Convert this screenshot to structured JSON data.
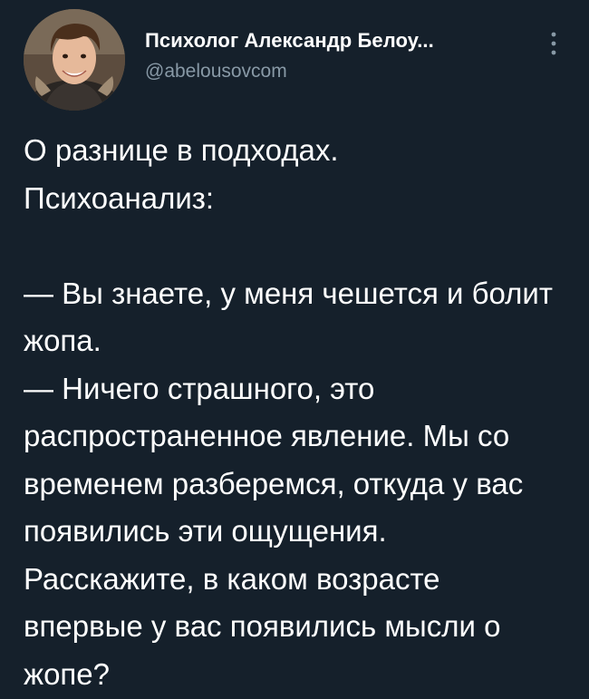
{
  "author": {
    "display_name": "Психолог Александр Белоу...",
    "handle": "@abelousovcom"
  },
  "tweet": {
    "text": "О разнице в подходах.\nПсихоанализ:\n\n— Вы знаете, у меня чешется и болит жопа.\n— Ничего страшного, это распространенное явление. Мы со временем разберемся, откуда у вас появились эти ощущения.  Расскажите, в каком возрасте впервые у вас появились мысли о жопе?"
  },
  "icons": {
    "more": "more-vertical-icon",
    "avatar": "profile-photo"
  },
  "colors": {
    "background": "#15202b",
    "text": "#ffffff",
    "secondary_text": "#8899a6"
  }
}
